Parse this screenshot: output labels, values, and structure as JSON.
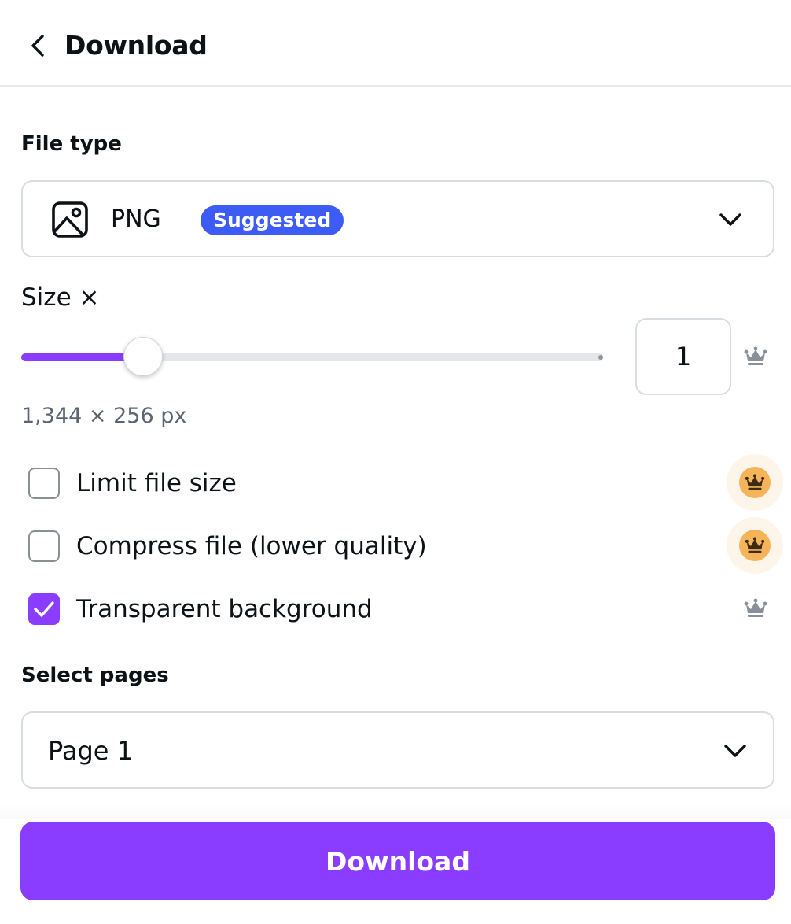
{
  "header": {
    "back_icon": "chevron-left-icon",
    "title": "Download"
  },
  "file_type": {
    "label": "File type",
    "icon": "image-icon",
    "selected": "PNG",
    "badge": "Suggested",
    "badge_color": "#3d5cf5"
  },
  "size": {
    "label": "Size ×",
    "multiplier": "1",
    "slider_fraction": 0.21,
    "dimensions": "1,344 × 256 px",
    "premium_icon": "crown-icon"
  },
  "options": [
    {
      "label": "Limit file size",
      "checked": false,
      "premium_icon": "crown-icon",
      "premium_style": "highlighted"
    },
    {
      "label": "Compress file (lower quality)",
      "checked": false,
      "premium_icon": "crown-icon",
      "premium_style": "highlighted"
    },
    {
      "label": "Transparent background",
      "checked": true,
      "premium_icon": "crown-icon",
      "premium_style": "plain"
    }
  ],
  "pages": {
    "label": "Select pages",
    "selected": "Page 1"
  },
  "download_button": {
    "label": "Download"
  },
  "colors": {
    "accent": "#8b3dff",
    "premium": "#f6b45a"
  }
}
